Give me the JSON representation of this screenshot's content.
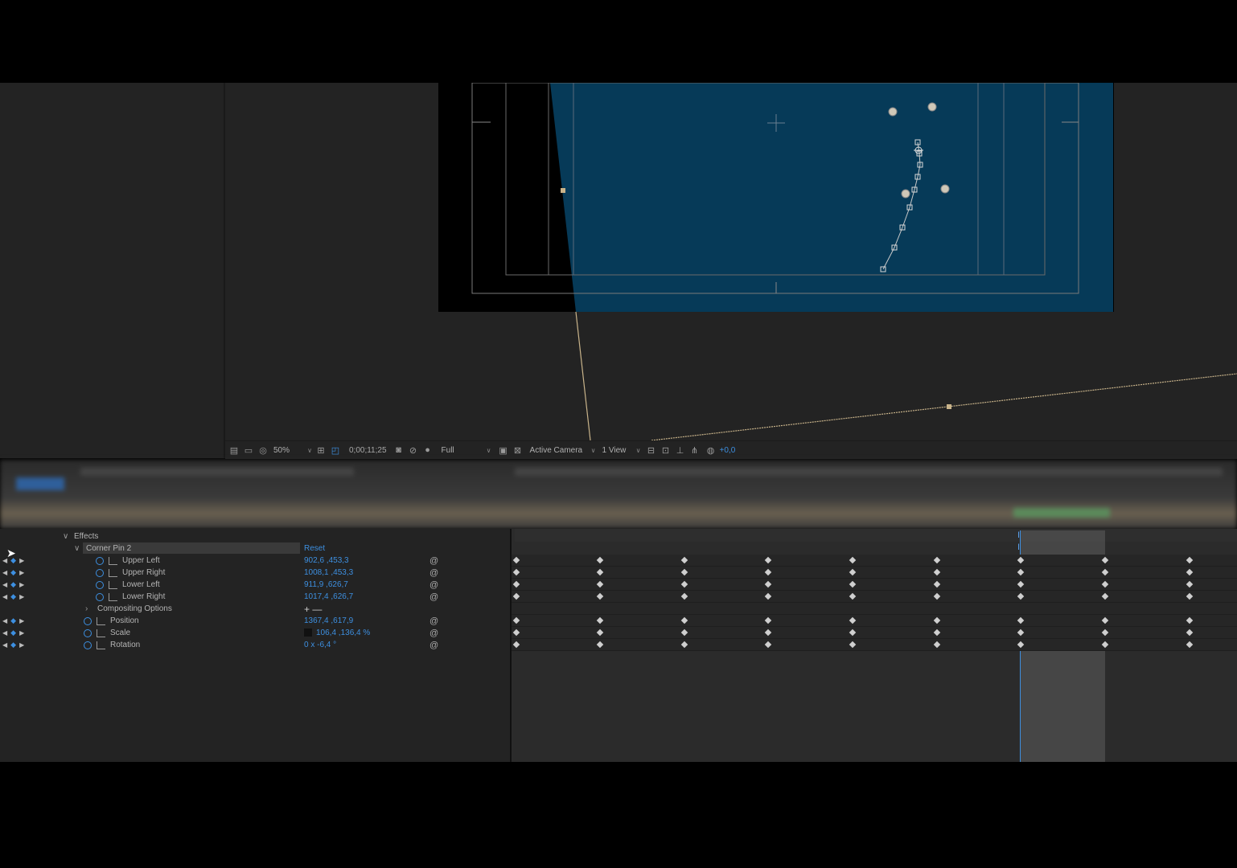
{
  "viewer_toolbar": {
    "zoom": "50%",
    "timecode": "0;00;11;25",
    "resolution": "Full",
    "camera": "Active Camera",
    "views": "1 View",
    "exposure": "+0,0"
  },
  "timeline": {
    "effects_label": "Effects",
    "effect_name": "Corner Pin 2",
    "reset_label": "Reset",
    "properties": [
      {
        "name": "Upper Left",
        "value": "902,6 ,453,3"
      },
      {
        "name": "Upper Right",
        "value": "1008,1 ,453,3"
      },
      {
        "name": "Lower Left",
        "value": "911,9 ,626,7"
      },
      {
        "name": "Lower Right",
        "value": "1017,4 ,626,7"
      }
    ],
    "compositing_label": "Compositing Options",
    "compositing_buttons": "+ —",
    "transform": [
      {
        "name": "Position",
        "value": "1367,4 ,617,9"
      },
      {
        "name": "Scale",
        "value": "106,4 ,136,4 %"
      },
      {
        "name": "Rotation",
        "value": "0 x -6,4 °"
      }
    ]
  },
  "colors": {
    "accent": "#3d8fe0",
    "layer_fill": "#063a58",
    "panel": "#232323"
  }
}
